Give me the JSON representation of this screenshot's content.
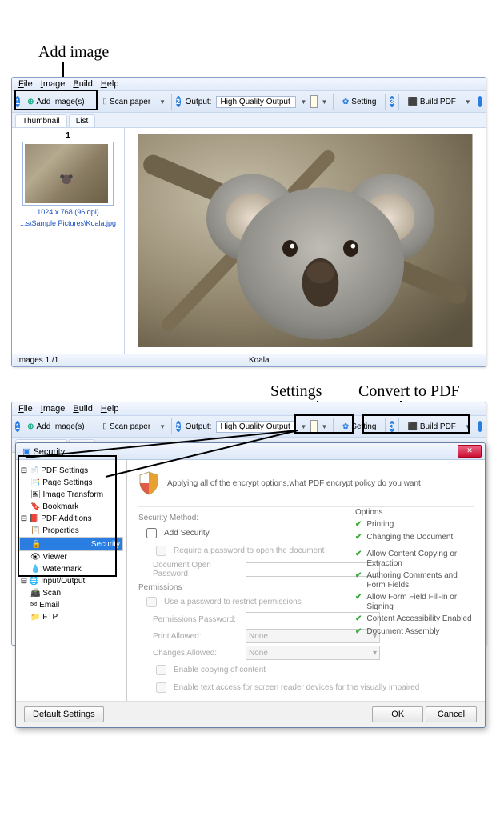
{
  "callouts": {
    "add_image": "Add image",
    "settings": "Settings",
    "convert": "Convert to PDF"
  },
  "menu": {
    "file": "File",
    "image": "Image",
    "build": "Build",
    "help": "Help"
  },
  "toolbar": {
    "step1": "1",
    "step2": "2",
    "step3": "3",
    "add_images": "Add Image(s)",
    "scan_paper": "Scan paper",
    "output_label": "Output:",
    "output_value": "High Quality Output",
    "setting": "Setting",
    "build_pdf": "Build PDF"
  },
  "tabs": {
    "thumbnail": "Thumbnail",
    "list": "List"
  },
  "thumbnail": {
    "index": "1",
    "meta_line1": "1024 x 768 (96 dpi)",
    "meta_line2": "...s\\Sample Pictures\\Koala.jpg"
  },
  "status": {
    "left": "Images 1 /1",
    "right": "Koala"
  },
  "dialog": {
    "title": "Security",
    "banner": "Applying all of the encrypt options,what PDF encrypt policy do you want",
    "tree": {
      "pdf_settings": "PDF Settings",
      "page_settings": "Page Settings",
      "image_transform": "Image Transform",
      "bookmark": "Bookmark",
      "pdf_additions": "PDF Additions",
      "properties": "Properties",
      "security": "Security",
      "viewer": "Viewer",
      "watermark": "Watermark",
      "input_output": "Input/Output",
      "scan": "Scan",
      "email": "Email",
      "ftp": "FTP"
    },
    "form": {
      "sec_method": "Security Method:",
      "add_security": "Add Security",
      "require_pw_open": "Require a password to open the document",
      "doc_open_pw": "Document Open Password",
      "permissions": "Permissions",
      "use_pw_restrict": "Use a password to restrict permissions",
      "perm_pw": "Permissions Password:",
      "print_allowed": "Print Allowed:",
      "changes_allowed": "Changes Allowed:",
      "none": "None",
      "enable_copy": "Enable copying of content",
      "enable_sr": "Enable text access for screen reader devices for the visually impaired"
    },
    "options": {
      "header": "Options",
      "printing": "Printing",
      "changing": "Changing the Document",
      "copy": "Allow Content Copying or Extraction",
      "auth": "Authoring Comments and Form Fields",
      "form_fill": "Allow Form Field Fill-in or Signing",
      "access": "Content Accessibility Enabled",
      "assembly": "Document Assembly"
    },
    "buttons": {
      "defaults": "Default Settings",
      "ok": "OK",
      "cancel": "Cancel"
    }
  }
}
